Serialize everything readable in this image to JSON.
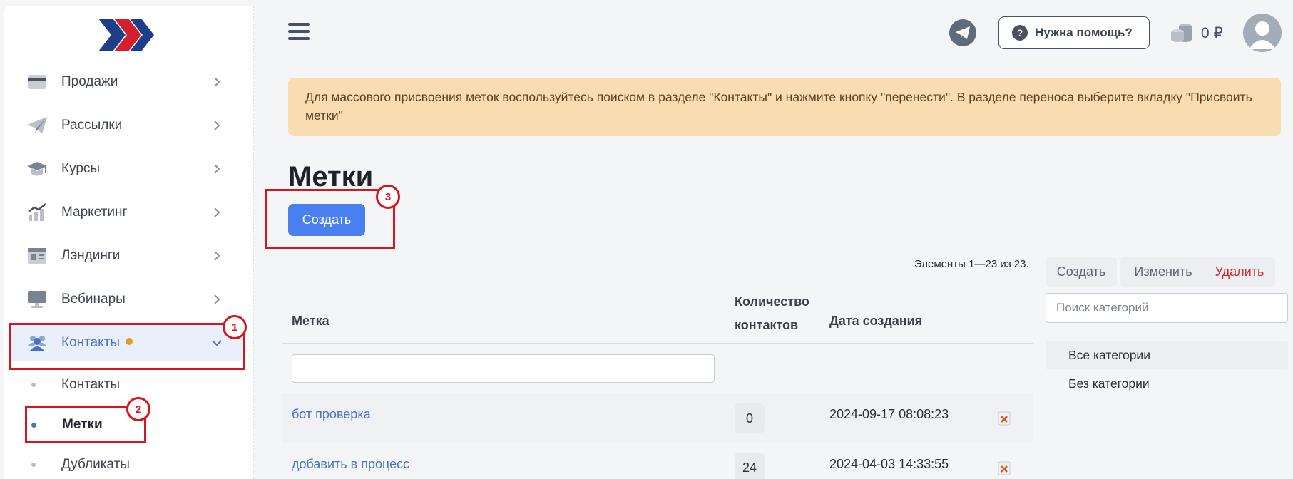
{
  "sidebar": {
    "items": [
      {
        "label": "Продажи",
        "icon": "card-icon"
      },
      {
        "label": "Рассылки",
        "icon": "paper-plane-icon"
      },
      {
        "label": "Курсы",
        "icon": "graduation-cap-icon"
      },
      {
        "label": "Маркетинг",
        "icon": "chart-growth-icon"
      },
      {
        "label": "Лэндинги",
        "icon": "landing-page-icon"
      },
      {
        "label": "Вебинары",
        "icon": "monitor-icon"
      },
      {
        "label": "Контакты",
        "icon": "users-icon"
      }
    ],
    "sub_items": [
      {
        "label": "Контакты"
      },
      {
        "label": "Метки"
      },
      {
        "label": "Дубликаты"
      }
    ]
  },
  "annotations": [
    "1",
    "2",
    "3"
  ],
  "header": {
    "help_label": "Нужна помощь?",
    "help_icon_glyph": "?",
    "balance": "0 ₽"
  },
  "notice": "Для массового присвоения меток воспользуйтесь поиском в разделе \"Контакты\" и нажмите кнопку \"перенести\". В разделе переноса выберите вкладку \"Присвоить метки\"",
  "page": {
    "title": "Метки",
    "create_label": "Создать",
    "summary": "Элементы 1—23 из 23."
  },
  "table": {
    "headers": {
      "name": "Метка",
      "count_line1": "Количество",
      "count_line2": "контактов",
      "date": "Дата создания"
    },
    "rows": [
      {
        "name": "бот проверка",
        "count": "0",
        "date": "2024-09-17 08:08:23"
      },
      {
        "name": "добавить в процесс",
        "count": "24",
        "date": "2024-04-03 14:33:55"
      }
    ]
  },
  "categories": {
    "create_label": "Создать",
    "edit_label": "Изменить",
    "delete_label": "Удалить",
    "search_placeholder": "Поиск категорий",
    "items": [
      "Все категории",
      "Без категории"
    ]
  },
  "colors": {
    "accent": "#4a7ff0",
    "annotation": "#d8141c",
    "notice_bg": "#f8dcb2",
    "link": "#4a72c4"
  }
}
